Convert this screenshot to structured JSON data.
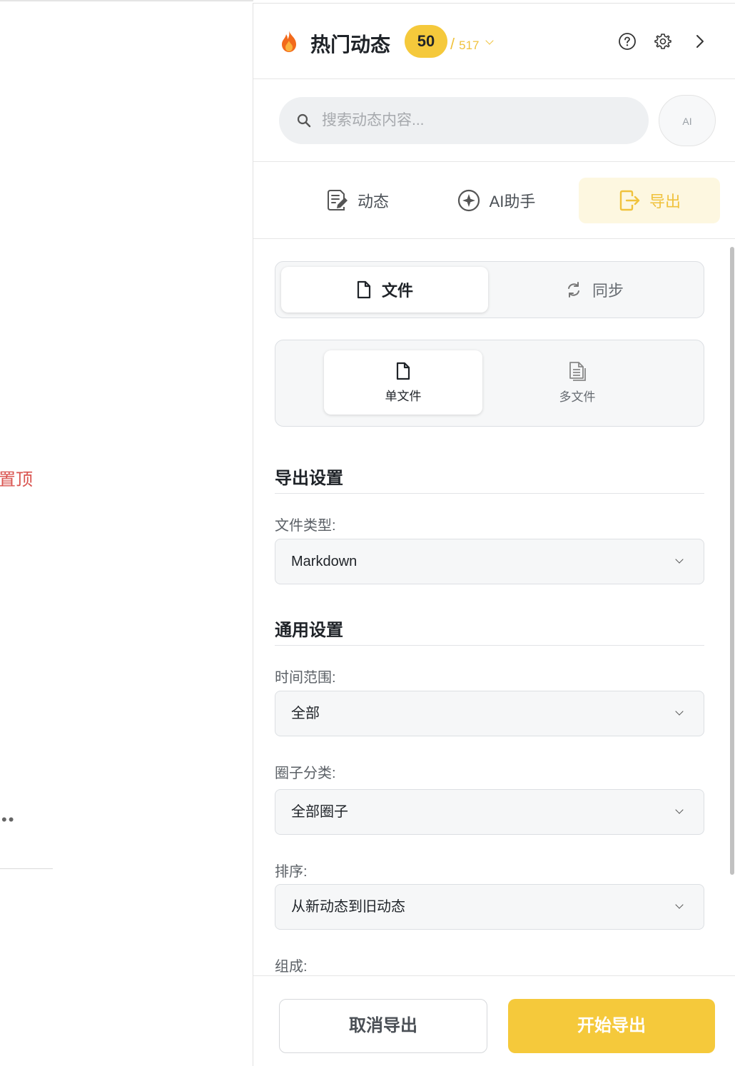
{
  "background": {
    "pin_text": "置顶",
    "more_text": "••"
  },
  "header": {
    "title": "热门动态",
    "count": "50",
    "total": "517",
    "icons": [
      "flame-icon",
      "help-icon",
      "gear-icon",
      "chevron-right-icon"
    ]
  },
  "search": {
    "placeholder": "搜索动态内容...",
    "ai_label": "AI"
  },
  "tabs": [
    {
      "label": "动态",
      "icon": "edit-note-icon",
      "active": false
    },
    {
      "label": "AI助手",
      "icon": "sparkle-icon",
      "active": false
    },
    {
      "label": "导出",
      "icon": "export-icon",
      "active": true
    }
  ],
  "export_mode": {
    "options": [
      {
        "label": "文件",
        "icon": "file-icon",
        "active": true
      },
      {
        "label": "同步",
        "icon": "sync-icon",
        "active": false
      }
    ]
  },
  "file_mode": {
    "options": [
      {
        "label": "单文件",
        "icon": "file-icon",
        "active": true
      },
      {
        "label": "多文件",
        "icon": "files-icon",
        "active": false
      }
    ]
  },
  "export_settings": {
    "title": "导出设置",
    "file_type_label": "文件类型:",
    "file_type_value": "Markdown"
  },
  "general_settings": {
    "title": "通用设置",
    "time_range_label": "时间范围:",
    "time_range_value": "全部",
    "circle_label": "圈子分类:",
    "circle_value": "全部圈子",
    "sort_label": "排序:",
    "sort_value": "从新动态到旧动态",
    "compose_label": "组成:"
  },
  "footer": {
    "cancel_label": "取消导出",
    "start_label": "开始导出"
  },
  "colors": {
    "accent": "#f5c93b",
    "accent_text": "#f0c23c",
    "active_tab_bg": "#fdf7e0",
    "pin_red": "#d9534f"
  }
}
